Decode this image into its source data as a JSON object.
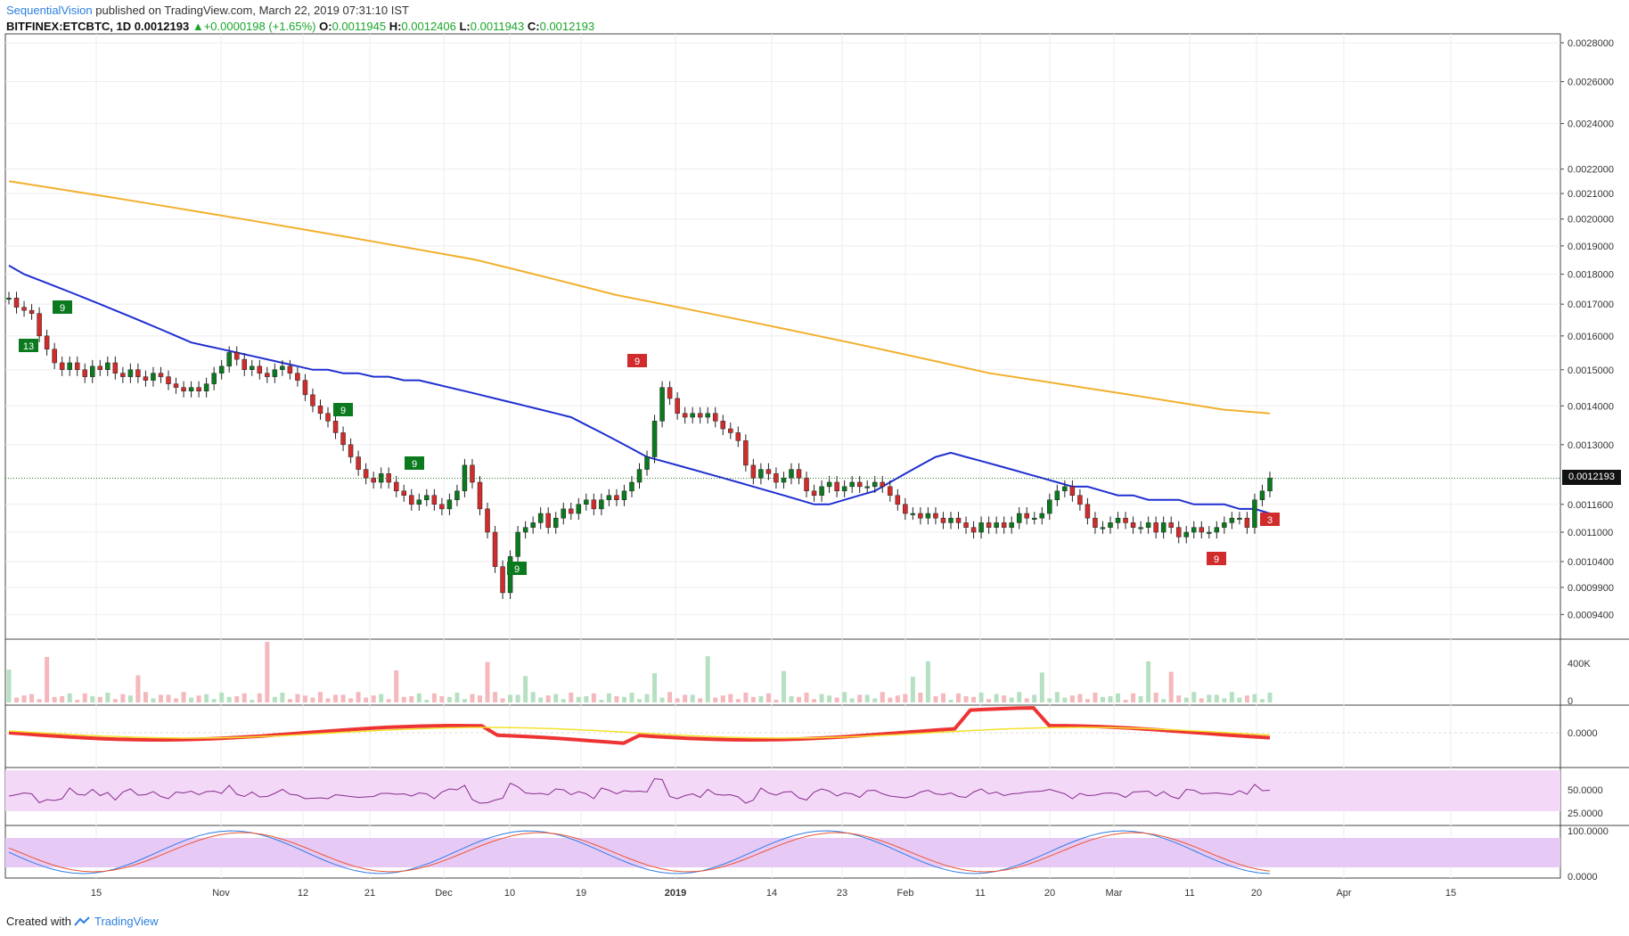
{
  "header": {
    "author": "SequentialVision",
    "published": "published on TradingView.com, March 22, 2019 07:31:10 IST"
  },
  "symbol": {
    "name": "BITFINEX:ETCBTC, 1D",
    "last": "0.0012193",
    "change": "+0.0000198 (+1.65%)",
    "o_label": "O:",
    "o": "0.0011945",
    "h_label": "H:",
    "h": "0.0012406",
    "l_label": "L:",
    "l": "0.0011943",
    "c_label": "C:",
    "c": "0.0012193"
  },
  "footer": {
    "created": "Created with",
    "brand": "TradingView"
  },
  "last_price_badge": "0.0012193",
  "colors": {
    "up": "#0b7a1f",
    "down": "#d12c2c",
    "ema_blue": "#1f2fd0",
    "ma_orange": "#f2b02d",
    "green_line": "#3c9d3c",
    "rsi_line": "#8a2b8f",
    "rsi_band": "#f3d9f7",
    "stoch_band": "#e7c9f5"
  },
  "chart_data": {
    "type": "line",
    "title": "",
    "x_ticks": [
      "15",
      "Nov",
      "12",
      "21",
      "Dec",
      "10",
      "19",
      "2019",
      "14",
      "23",
      "Feb",
      "11",
      "20",
      "Mar",
      "11",
      "20",
      "Apr",
      "15"
    ],
    "price_axis": {
      "ylim": [
        0.00092,
        0.0028
      ],
      "ticks": [
        "0.0028000",
        "0.0026000",
        "0.0024000",
        "0.0022000",
        "0.0021000",
        "0.0020000",
        "0.0019000",
        "0.0018000",
        "0.0017000",
        "0.0016000",
        "0.0015000",
        "0.0014000",
        "0.0013000",
        "0.0011600",
        "0.0011000",
        "0.0010400",
        "0.0009900",
        "0.0009400"
      ],
      "scale": "log"
    },
    "series": [
      {
        "values": [
          0.00172,
          0.00169,
          0.00168,
          0.00167,
          0.0016,
          0.00156,
          0.00152,
          0.0015,
          0.00152,
          0.0015,
          0.00148,
          0.00151,
          0.0015,
          0.00152,
          0.00149,
          0.00148,
          0.0015,
          0.00148,
          0.00147,
          0.00149,
          0.00148,
          0.00146,
          0.00145,
          0.00144,
          0.00145,
          0.00144,
          0.00146,
          0.00149,
          0.00151,
          0.00155,
          0.00153,
          0.0015,
          0.00151,
          0.00149,
          0.00148,
          0.0015,
          0.00151,
          0.00149,
          0.00147,
          0.00143,
          0.0014,
          0.00138,
          0.00136,
          0.00133,
          0.0013,
          0.00127,
          0.00124,
          0.00122,
          0.00121,
          0.00123,
          0.00121,
          0.00119,
          0.00118,
          0.00116,
          0.00117,
          0.00118,
          0.00116,
          0.00115,
          0.00117,
          0.00119,
          0.00125,
          0.00121,
          0.00115,
          0.0011,
          0.00103,
          0.00098,
          0.00105,
          0.0011,
          0.00111,
          0.00112,
          0.00114,
          0.00111,
          0.00113,
          0.00115,
          0.00114,
          0.00116,
          0.00117,
          0.00115,
          0.00117,
          0.00118,
          0.00117,
          0.00119,
          0.00121,
          0.00124,
          0.00127,
          0.00136,
          0.00145,
          0.00142,
          0.00138,
          0.00137,
          0.00138,
          0.00137,
          0.00138,
          0.00136,
          0.00134,
          0.00133,
          0.00131,
          0.00125,
          0.00122,
          0.00124,
          0.00123,
          0.00121,
          0.00122,
          0.00124,
          0.00122,
          0.00119,
          0.00118,
          0.0012,
          0.00121,
          0.00119,
          0.0012,
          0.00121,
          0.0012,
          0.0012,
          0.00121,
          0.0012,
          0.00118,
          0.00116,
          0.00114,
          0.00114,
          0.00113,
          0.00114,
          0.00113,
          0.00112,
          0.00113,
          0.00112,
          0.00111,
          0.0011,
          0.00112,
          0.00111,
          0.00112,
          0.00111,
          0.00112,
          0.00114,
          0.00113,
          0.00113,
          0.00114,
          0.00117,
          0.00119,
          0.0012,
          0.00118,
          0.00116,
          0.00113,
          0.00111,
          0.00111,
          0.00112,
          0.00113,
          0.00112,
          0.00111,
          0.00111,
          0.00112,
          0.0011,
          0.00112,
          0.00111,
          0.00109,
          0.0011,
          0.00111,
          0.0011,
          0.0011,
          0.00111,
          0.00112,
          0.00113,
          0.00113,
          0.00111,
          0.00117,
          0.00119,
          0.00122
        ]
      },
      {
        "values": [
          0.00183,
          0.0018,
          0.00178,
          0.00176,
          0.00174,
          0.00172,
          0.0017,
          0.00168,
          0.00166,
          0.00164,
          0.00162,
          0.0016,
          0.00158,
          0.00157,
          0.00156,
          0.00155,
          0.00154,
          0.00153,
          0.00152,
          0.00151,
          0.0015,
          0.0015,
          0.00149,
          0.00149,
          0.00148,
          0.00148,
          0.00147,
          0.00147,
          0.00146,
          0.00145,
          0.00144,
          0.00143,
          0.00142,
          0.00141,
          0.0014,
          0.00139,
          0.00138,
          0.00137,
          0.00135,
          0.00133,
          0.00131,
          0.00129,
          0.00127,
          0.00126,
          0.00125,
          0.00124,
          0.00123,
          0.00122,
          0.00121,
          0.0012,
          0.00119,
          0.00118,
          0.00117,
          0.00116,
          0.00116,
          0.00117,
          0.00118,
          0.00119,
          0.00121,
          0.00123,
          0.00125,
          0.00127,
          0.00128,
          0.00127,
          0.00126,
          0.00125,
          0.00124,
          0.00123,
          0.00122,
          0.00121,
          0.0012,
          0.0012,
          0.00119,
          0.00118,
          0.00118,
          0.00117,
          0.00117,
          0.00117,
          0.00116,
          0.00116,
          0.00116,
          0.00115,
          0.00115,
          0.00114
        ]
      },
      {
        "values": [
          0.00215,
          0.00212,
          0.00209,
          0.00206,
          0.00203,
          0.002,
          0.00197,
          0.00194,
          0.00191,
          0.00188,
          0.00185,
          0.00181,
          0.00177,
          0.00173,
          0.0017,
          0.00167,
          0.00164,
          0.00161,
          0.00158,
          0.00155,
          0.00152,
          0.00149,
          0.00147,
          0.00145,
          0.00143,
          0.00141,
          0.00139,
          0.00138
        ]
      }
    ],
    "volume_axis": {
      "ticks": [
        "400K",
        "0"
      ]
    },
    "macd_axis": {
      "ticks": [
        "0.0000"
      ]
    },
    "rsi_axis": {
      "ticks": [
        "50.0000",
        "25.0000"
      ]
    },
    "stoch_axis": {
      "ticks": [
        "100.0000",
        "0.0000"
      ]
    },
    "annotations": [
      "13",
      "9",
      "9",
      "9",
      "9",
      "9",
      "9",
      "3"
    ]
  }
}
